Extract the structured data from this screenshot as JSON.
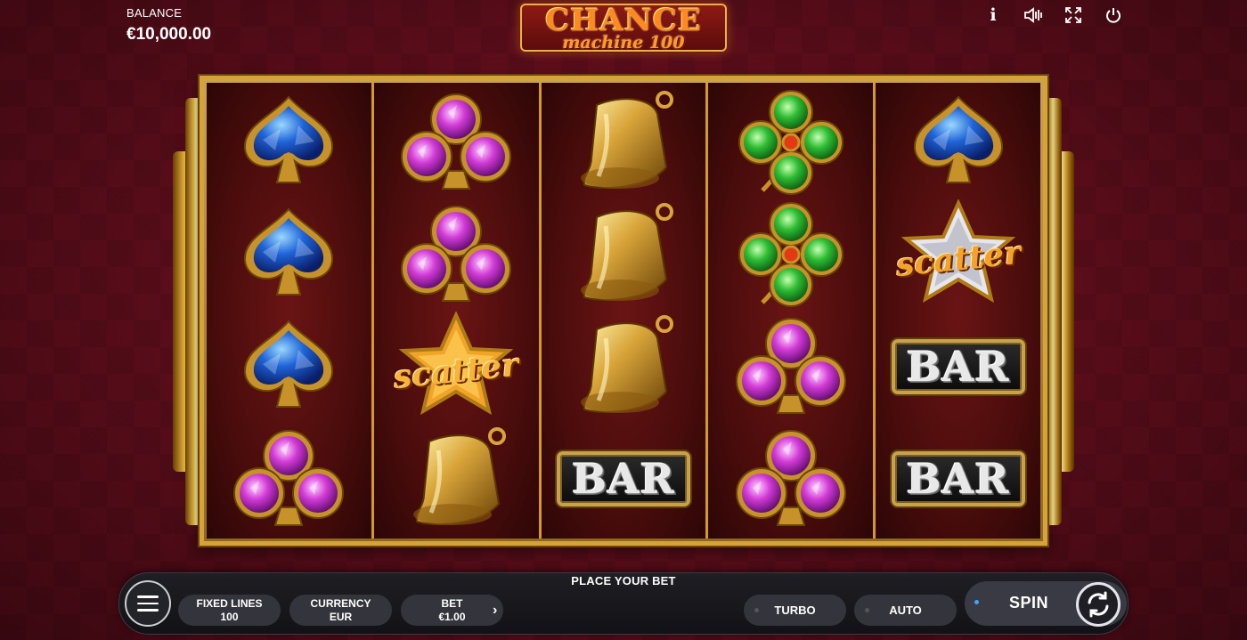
{
  "header": {
    "balance_label": "BALANCE",
    "balance_value": "€10,000.00",
    "logo_line1": "CHANCE",
    "logo_line2": "machine 100",
    "icons": [
      "info-icon",
      "sound-icon",
      "fullscreen-icon",
      "power-icon"
    ],
    "info_glyph": "i"
  },
  "reels": [
    [
      "spade-blue",
      "spade-blue",
      "spade-blue",
      "club-purple"
    ],
    [
      "club-purple",
      "club-purple",
      "scatter-gold",
      "bell"
    ],
    [
      "bell",
      "bell",
      "bell",
      "bar"
    ],
    [
      "clover-green",
      "clover-green",
      "club-purple",
      "club-purple"
    ],
    [
      "spade-blue",
      "scatter-silver",
      "bar",
      "bar"
    ]
  ],
  "symbol_text": {
    "bar": "BAR",
    "scatter": "scatter"
  },
  "panel": {
    "prompt": "PLACE YOUR BET",
    "lines_label": "FIXED LINES",
    "lines_value": "100",
    "currency_label": "CURRENCY",
    "currency_value": "EUR",
    "bet_label": "BET",
    "bet_value": "€1.00",
    "bet_arrow": "›",
    "turbo_label": "TURBO",
    "auto_label": "AUTO",
    "spin_label": "SPIN"
  },
  "colors": {
    "background": "#5e0e1b",
    "frame_gold": "#d6a23a",
    "reel_bg": "#4a0c0c",
    "panel_bg": "#1a1a1f",
    "spin_indicator": "#39a6ff"
  }
}
